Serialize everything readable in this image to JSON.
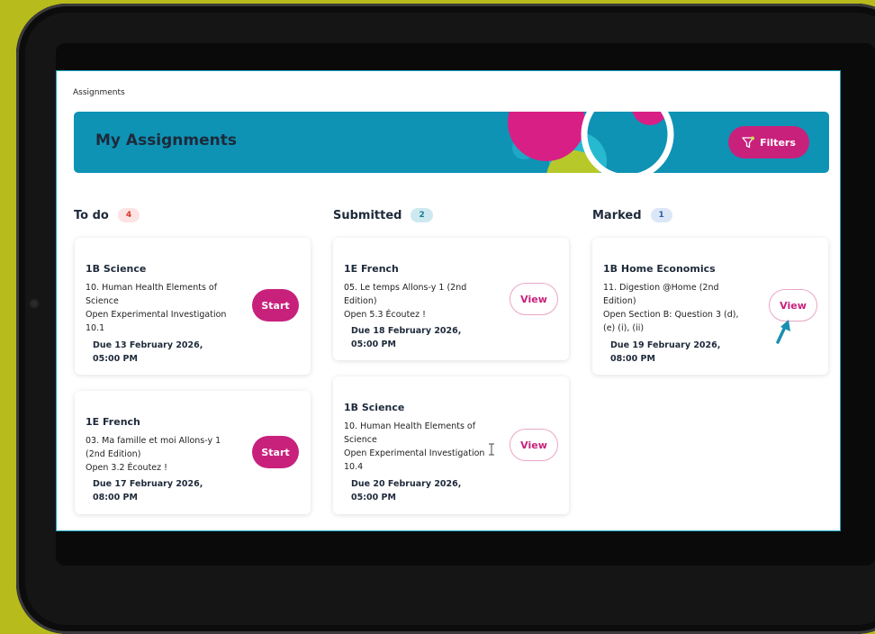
{
  "breadcrumb": "Assignments",
  "banner": {
    "title": "My Assignments",
    "filters_label": "Filters"
  },
  "columns": [
    {
      "title": "To do",
      "count": "4"
    },
    {
      "title": "Submitted",
      "count": "2"
    },
    {
      "title": "Marked",
      "count": "1"
    }
  ],
  "todo": [
    {
      "subject": "1B Science",
      "desc": [
        "10. Human Health Elements of",
        "Science",
        "Open Experimental Investigation",
        "10.1"
      ],
      "due": [
        "Due 13 February 2026,",
        "05:00 PM"
      ],
      "action": "Start"
    },
    {
      "subject": "1E French",
      "desc": [
        "03. Ma famille et moi Allons-y 1",
        "(2nd Edition)",
        "Open 3.2 Écoutez !"
      ],
      "due": [
        "Due 17 February 2026,",
        "08:00 PM"
      ],
      "action": "Start"
    }
  ],
  "submitted": [
    {
      "subject": "1E French",
      "desc": [
        "05. Le temps Allons-y 1 (2nd",
        "Edition)",
        "Open 5.3 Écoutez !"
      ],
      "due": [
        "Due 18 February 2026,",
        "05:00 PM"
      ],
      "action": "View"
    },
    {
      "subject": "1B Science",
      "desc": [
        "10. Human Health Elements of",
        "Science",
        "Open Experimental Investigation",
        "10.4"
      ],
      "due": [
        "Due 20 February 2026,",
        "05:00 PM"
      ],
      "action": "View"
    }
  ],
  "marked": [
    {
      "subject": "1B Home Economics",
      "desc": [
        "11. Digestion @Home (2nd",
        "Edition)",
        "Open Section B: Question 3 (d),",
        "(e) (i), (ii)"
      ],
      "due": [
        "Due 19 February 2026,",
        "08:00 PM"
      ],
      "action": "View"
    }
  ],
  "colors": {
    "background": "#b7bb1c",
    "banner": "#0e93b5",
    "accent": "#c8217c",
    "arrow": "#1a8fb0"
  },
  "icons": [
    "filter-icon",
    "arrow-pointer-icon",
    "text-cursor-icon"
  ]
}
